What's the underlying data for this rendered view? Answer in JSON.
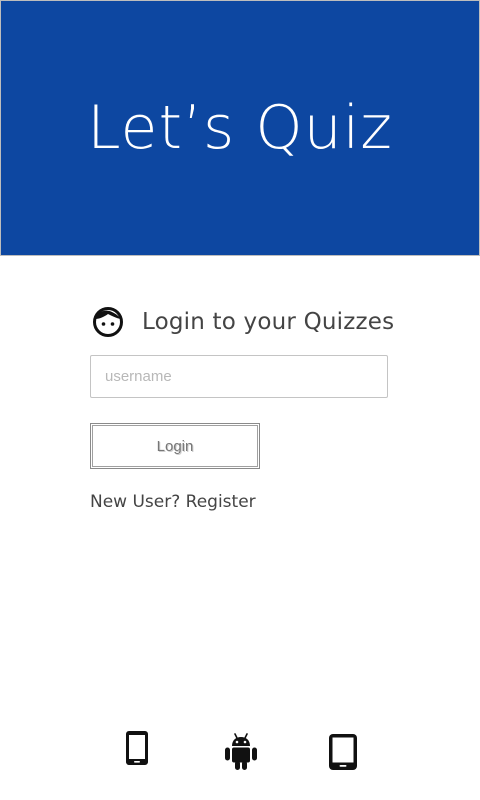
{
  "colors": {
    "hero_background": "#0d47a1",
    "hero_text": "#ffffff",
    "icon_color": "#111111"
  },
  "hero": {
    "title": "Let’s Quiz"
  },
  "login": {
    "heading_icon": "face-icon",
    "heading": "Login to your Quizzes",
    "username_placeholder": "username",
    "username_value": "",
    "login_button_label": "Login",
    "register_link": "New User? Register"
  },
  "platforms": {
    "icons": [
      "phone-icon",
      "android-icon",
      "tablet-icon"
    ]
  }
}
